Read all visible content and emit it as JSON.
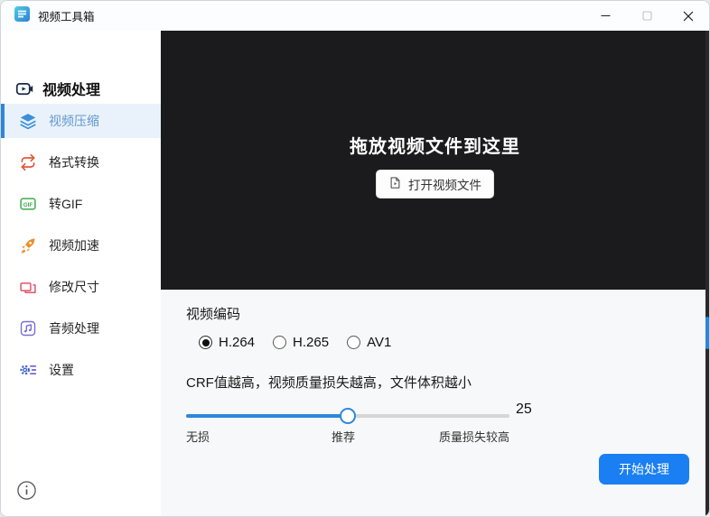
{
  "window": {
    "title": "视频工具箱",
    "controls": {
      "minimize": "minimize",
      "maximize": "maximize",
      "close": "close"
    }
  },
  "sidebar": {
    "header": {
      "label": "视频处理",
      "icon": "video-camera-icon"
    },
    "items": [
      {
        "label": "视频压缩",
        "icon": "layers-icon",
        "color": "#3c8fdb",
        "selected": true
      },
      {
        "label": "格式转换",
        "icon": "convert-arrows-icon",
        "color": "#e2593a",
        "selected": false
      },
      {
        "label": "转GIF",
        "icon": "gif-badge-icon",
        "color": "#3fa94e",
        "selected": false
      },
      {
        "label": "视频加速",
        "icon": "rocket-icon",
        "color": "#e8912d",
        "selected": false
      },
      {
        "label": "修改尺寸",
        "icon": "resize-frames-icon",
        "color": "#e0556a",
        "selected": false
      },
      {
        "label": "音频处理",
        "icon": "music-note-icon",
        "color": "#7a6fd0",
        "selected": false
      },
      {
        "label": "设置",
        "icon": "gear-sliders-icon",
        "color": "#3a62c4",
        "selected": false
      }
    ],
    "info_icon": "info-icon"
  },
  "dropzone": {
    "title": "拖放视频文件到这里",
    "open_button_label": "打开视频文件"
  },
  "settings": {
    "encoding_label": "视频编码",
    "codecs": [
      {
        "label": "H.264",
        "selected": true
      },
      {
        "label": "H.265",
        "selected": false
      },
      {
        "label": "AV1",
        "selected": false
      }
    ],
    "crf_hint": "CRF值越高，视频质量损失越高，文件体积越小",
    "slider": {
      "value": "25",
      "percent": 50,
      "min_label": "无损",
      "mid_label": "推荐",
      "max_label": "质量损失较高"
    },
    "start_button_label": "开始处理"
  },
  "colors": {
    "accent_blue": "#2e86d8",
    "button_blue": "#1a7ff2",
    "dark_zone": "#1b1b1d",
    "selected_bg": "#e9f2fb",
    "panel_bg": "#f7f8f9"
  }
}
